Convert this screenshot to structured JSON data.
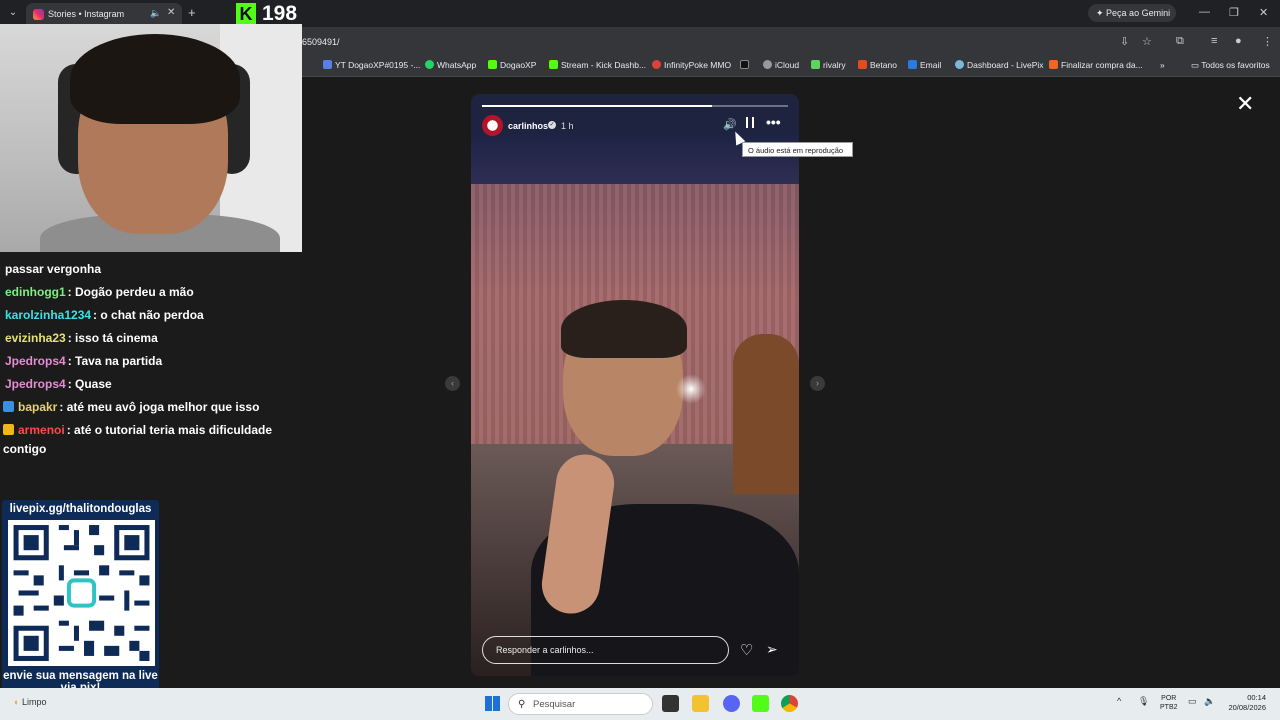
{
  "browser": {
    "tab_title": "Stories • Instagram",
    "viewer_count": "198",
    "gemini_label": "Peça ao Gemini",
    "url_fragment": "6509491/",
    "bookmarks": [
      {
        "label": "YT DogaoXP#0195 -...",
        "color": "#5b7fe0"
      },
      {
        "label": "WhatsApp",
        "color": "#25d366"
      },
      {
        "label": "DogaoXP",
        "color": "#53fc18"
      },
      {
        "label": "Stream - Kick Dashb...",
        "color": "#53fc18"
      },
      {
        "label": "InfinityPoke MMO",
        "color": "#e0403c"
      },
      {
        "label": "iCloud",
        "color": "#999999"
      },
      {
        "label": "rivalry",
        "color": "#5fd35f"
      },
      {
        "label": "Betano",
        "color": "#e24c1f"
      },
      {
        "label": "Email",
        "color": "#2a7ae2"
      },
      {
        "label": "Dashboard - LivePix",
        "color": "#7ab8d8"
      },
      {
        "label": "Finalizar compra da...",
        "color": "#f26522"
      }
    ],
    "favorites_label": "Todos os favoritos"
  },
  "chat": {
    "partial_line": "passar vergonha",
    "messages": [
      {
        "user": "edinhogg1",
        "text": ": Dogão perdeu a mão",
        "color": "#7cf07c",
        "badge": ""
      },
      {
        "user": "karolzinha1234",
        "text": ": o chat não perdoa",
        "color": "#3ee0e8",
        "badge": ""
      },
      {
        "user": "evizinha23",
        "text": ": isso tá cinema",
        "color": "#e6e07a",
        "badge": ""
      },
      {
        "user": "Jpedrops4",
        "text": ": Tava na partida",
        "color": "#e68bd4",
        "badge": ""
      },
      {
        "user": "Jpedrops4",
        "text": ": Quase",
        "color": "#e68bd4",
        "badge": ""
      },
      {
        "user": "bapakr",
        "text": ": até meu avô joga melhor que isso",
        "color": "#e6d36b",
        "badge": "#3a8fe0"
      },
      {
        "user": "armenoi",
        "text": ": até o tutorial teria mais dificuldade contigo",
        "color": "#ff4a4a",
        "badge": "#f2b51b"
      }
    ]
  },
  "qr": {
    "top_text": "livepix.gg/thalitondouglas",
    "bottom_text": "envie sua mensagem na live via pix!"
  },
  "story": {
    "username": "carlinhos",
    "time": "1 h",
    "tooltip": "O áudio está em reprodução",
    "reply_placeholder": "Responder a carlinhos...",
    "progress": 0.75
  },
  "taskbar": {
    "weather": "Limpo",
    "search_placeholder": "Pesquisar",
    "lang_line1": "POR",
    "lang_line2": "PTB2",
    "time": "00:14",
    "date": "20/08/2026"
  }
}
